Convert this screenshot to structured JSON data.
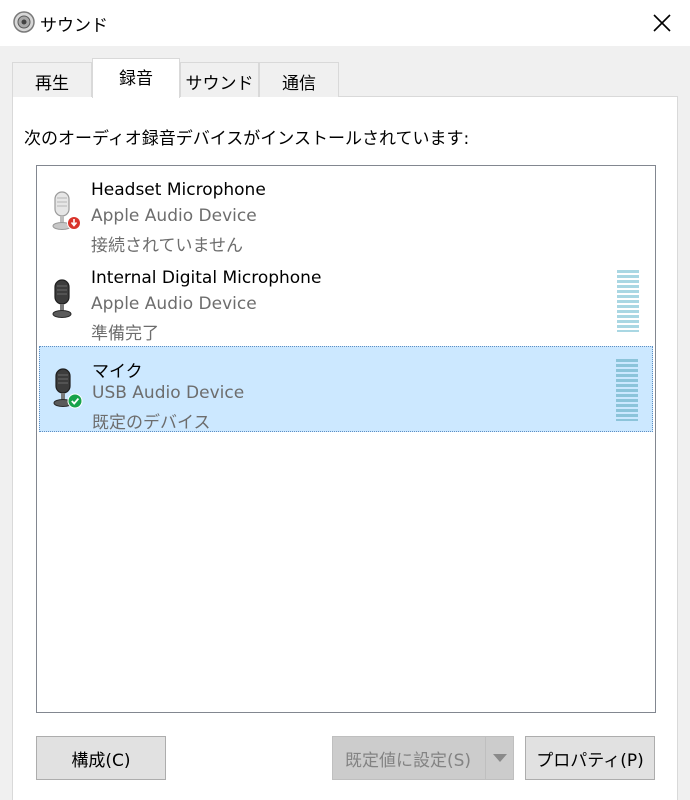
{
  "window": {
    "title": "サウンド",
    "close_glyph": "✕"
  },
  "tabs": [
    {
      "label": "再生"
    },
    {
      "label": "録音"
    },
    {
      "label": "サウンド"
    },
    {
      "label": "通信"
    }
  ],
  "active_tab": "録音",
  "instruction": "次のオーディオ録音デバイスがインストールされています:",
  "devices": [
    {
      "name": "Headset Microphone",
      "type": "Apple Audio Device",
      "status": "接続されていません",
      "icon": "microphone-disconnected-icon",
      "level_meter": false
    },
    {
      "name": "Internal Digital Microphone",
      "type": "Apple Audio Device",
      "status": "準備完了",
      "icon": "microphone-icon",
      "level_meter": true
    },
    {
      "name": "マイク",
      "type": "USB Audio Device",
      "status": "既定のデバイス",
      "icon": "microphone-default-icon",
      "level_meter": true,
      "selected": true
    }
  ],
  "buttons": {
    "configure": "構成(C)",
    "set_default": "既定値に設定(S)",
    "properties": "プロパティ(P)"
  },
  "colors": {
    "selection": "#cce8ff",
    "meter": "#a9d7e3",
    "disconnected_badge": "#d9342b",
    "default_badge": "#17a34a"
  }
}
